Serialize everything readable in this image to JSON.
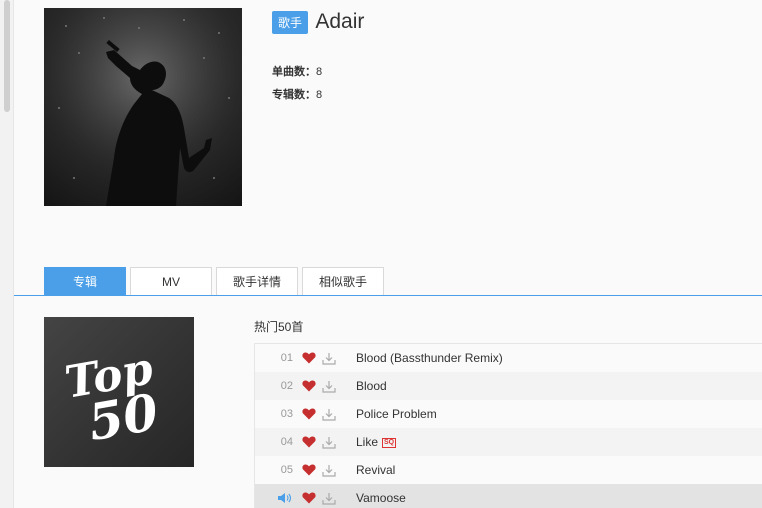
{
  "artist": {
    "tag": "歌手",
    "name": "Adair",
    "stats": [
      {
        "label": "单曲数：",
        "value": "8"
      },
      {
        "label": "专辑数：",
        "value": "8"
      }
    ]
  },
  "tabs": [
    {
      "label": "专辑",
      "active": true
    },
    {
      "label": "MV",
      "active": false
    },
    {
      "label": "歌手详情",
      "active": false
    },
    {
      "label": "相似歌手",
      "active": false
    }
  ],
  "album": {
    "cover_line1": "Top",
    "cover_line2": "50",
    "title": "热门50首"
  },
  "songs": [
    {
      "num": "01",
      "title": "Blood (Bassthunder Remix)",
      "liked": true,
      "playing": false,
      "sq": false
    },
    {
      "num": "02",
      "title": "Blood",
      "liked": true,
      "playing": false,
      "sq": false
    },
    {
      "num": "03",
      "title": "Police Problem",
      "liked": true,
      "playing": false,
      "sq": false
    },
    {
      "num": "04",
      "title": "Like",
      "liked": true,
      "playing": false,
      "sq": true,
      "badge": "SQ"
    },
    {
      "num": "05",
      "title": "Revival",
      "liked": true,
      "playing": false,
      "sq": false
    },
    {
      "num": "",
      "title": "Vamoose",
      "liked": true,
      "playing": true,
      "sq": false
    }
  ],
  "colors": {
    "accent": "#4a9fe8",
    "heart": "#c62f2f",
    "sq": "#dd3333"
  },
  "icons": {
    "like": "heart-icon",
    "download": "download-icon",
    "now_playing": "speaker-icon"
  }
}
